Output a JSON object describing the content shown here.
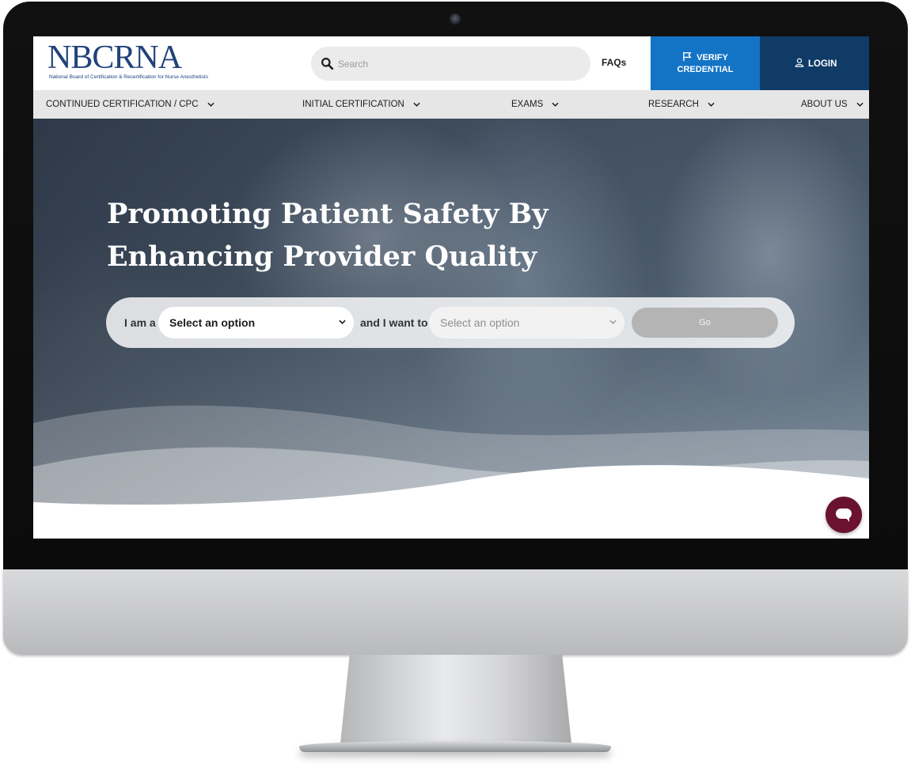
{
  "header": {
    "logo": {
      "main": "NBCRNA",
      "sub": "National Board of Certification & Recertification for Nurse Anesthetists"
    },
    "search": {
      "placeholder": "Search",
      "icon": "search-icon"
    },
    "faqs_label": "FAQs",
    "verify": {
      "line1": "VERIFY",
      "line2": "CREDENTIAL",
      "icon": "flag-icon",
      "color": "#1374c6"
    },
    "login": {
      "label": "LOGIN",
      "icon": "user-icon",
      "color": "#0f3b66"
    }
  },
  "nav": {
    "items": [
      {
        "label": "CONTINUED CERTIFICATION / CPC"
      },
      {
        "label": "INITIAL CERTIFICATION"
      },
      {
        "label": "EXAMS"
      },
      {
        "label": "RESEARCH"
      },
      {
        "label": "ABOUT US"
      }
    ]
  },
  "hero": {
    "title_line1": "Promoting Patient Safety By",
    "title_line2": "Enhancing Provider Quality",
    "selector": {
      "prefix": "I am a",
      "select1_value": "Select an option",
      "middle": "and I want to",
      "select2_value": "Select an option",
      "go_label": "Go"
    }
  },
  "chat": {
    "icon": "chat-icon",
    "color": "#6a1230"
  }
}
